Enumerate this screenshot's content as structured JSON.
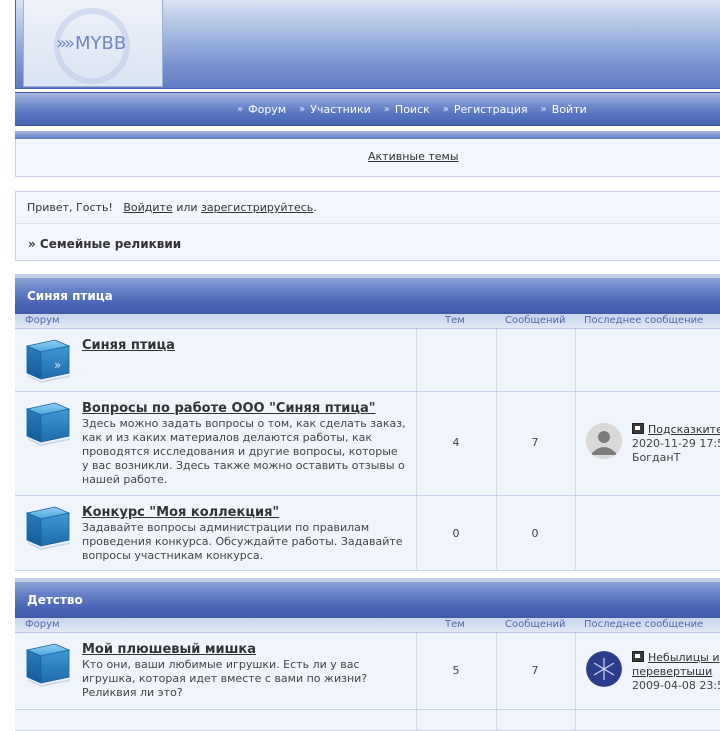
{
  "header": {
    "logo_text": "MYBB"
  },
  "nav": {
    "items": [
      "Форум",
      "Участники",
      "Поиск",
      "Регистрация",
      "Войти"
    ]
  },
  "active": {
    "link": "Активные темы"
  },
  "welcome": {
    "greeting": "Привет, Гость!",
    "login": "Войдите",
    "or": "или",
    "register": "зарегистрируйтесь",
    "period": ".",
    "breadcrumb": "» Семейные реликвии"
  },
  "columns": {
    "forum": "Форум",
    "topics": "Тем",
    "posts": "Сообщений",
    "last": "Последнее сообщение"
  },
  "categories": [
    {
      "title": "Синяя птица",
      "forums": [
        {
          "title": "Синяя птица",
          "desc": "",
          "topics": "",
          "posts": ""
        },
        {
          "title": "Вопросы по работе ООО \"Синяя птица\"",
          "desc": "Здесь можно задать вопросы о том, как сделать заказ, как и из каких материалов делаются работы, как проводятся исследования и другие вопросы, которые у вас возникли. Здесь также можно оставить отзывы о нашей работе.",
          "topics": "4",
          "posts": "7",
          "last": {
            "topic": "Подсказките",
            "date": "2020-11-29 17:5",
            "author": "БогданТ"
          }
        },
        {
          "title": "Конкурс \"Моя коллекция\"",
          "desc": "Задавайте вопросы администрации по правилам проведения конкурса. Обсуждайте работы. Задавайте вопросы участникам конкурса.",
          "topics": "0",
          "posts": "0"
        }
      ]
    },
    {
      "title": "Детство",
      "forums": [
        {
          "title": "Мой плюшевый мишка",
          "desc": "Кто они, ваши любимые игрушки. Есть ли у вас игрушка, которая идет вместе с вами по жизни? Реликвия ли это?",
          "topics": "5",
          "posts": "7",
          "last": {
            "topic": "Небылицы и",
            "topic2": "перевертыши",
            "date": "2009-04-08 23:5"
          }
        }
      ]
    }
  ]
}
